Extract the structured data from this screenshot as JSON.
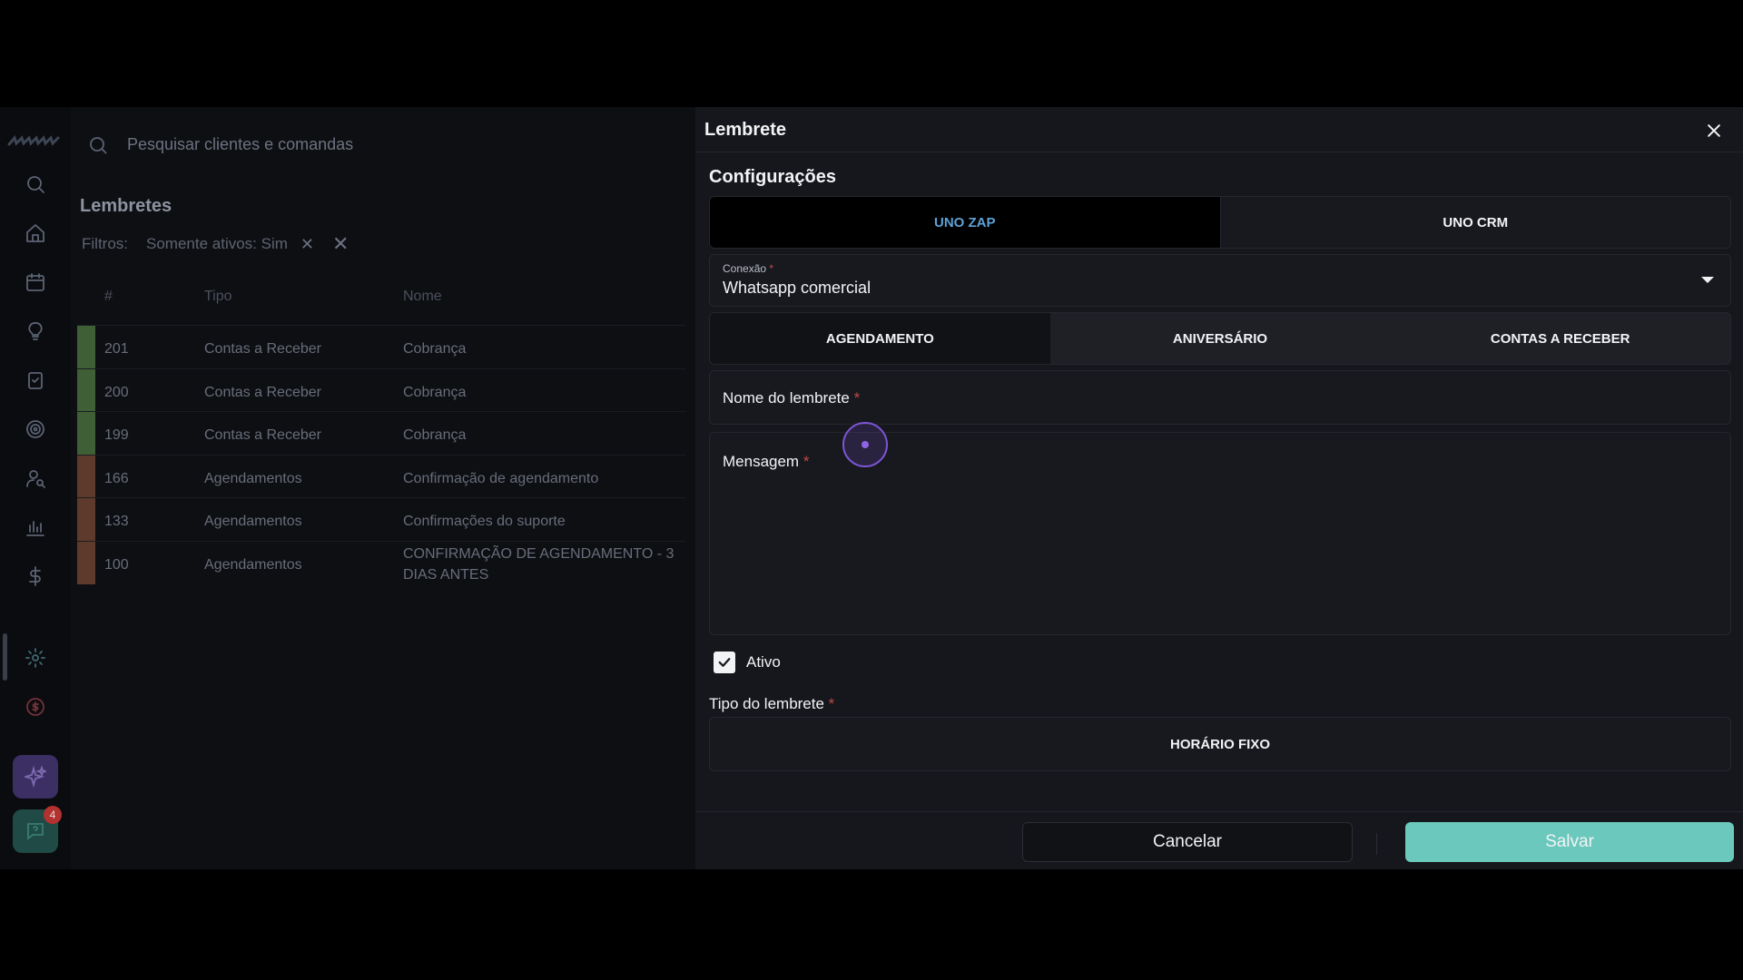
{
  "app": {
    "search": {
      "placeholder": "Pesquisar clientes e comandas"
    },
    "page_title": "Lembretes",
    "filters": {
      "label": "Filtros:",
      "chip": "Somente ativos: Sim"
    },
    "table": {
      "headers": [
        "#",
        "Tipo",
        "Nome"
      ],
      "rows": [
        {
          "id": "201",
          "tipo": "Contas a Receber",
          "nome": "Cobrança",
          "color": "#3f5f36"
        },
        {
          "id": "200",
          "tipo": "Contas a Receber",
          "nome": "Cobrança",
          "color": "#3f5f36"
        },
        {
          "id": "199",
          "tipo": "Contas a Receber",
          "nome": "Cobrança",
          "color": "#3f5f36"
        },
        {
          "id": "166",
          "tipo": "Agendamentos",
          "nome": "Confirmação de agendamento",
          "color": "#5e3a2c"
        },
        {
          "id": "133",
          "tipo": "Agendamentos",
          "nome": "Confirmações do suporte",
          "color": "#5e3a2c"
        },
        {
          "id": "100",
          "tipo": "Agendamentos",
          "nome": "CONFIRMAÇÃO DE AGENDAMENTO - 3 DIAS ANTES",
          "color": "#5e3a2c"
        }
      ]
    },
    "chat_badge": "4"
  },
  "modal": {
    "title": "Lembrete",
    "section_title": "Configurações",
    "platform_tabs": {
      "uno_zap": "UNO ZAP",
      "uno_crm": "UNO CRM"
    },
    "connection": {
      "label": "Conexão",
      "required_mark": "*",
      "value": "Whatsapp comercial"
    },
    "type_tabs": {
      "agendamento": "AGENDAMENTO",
      "aniversario": "ANIVERSÁRIO",
      "contas": "CONTAS A RECEBER"
    },
    "name_field": {
      "label": "Nome do lembrete",
      "required_mark": "*"
    },
    "message_field": {
      "label": "Mensagem",
      "required_mark": "*"
    },
    "active_checkbox": {
      "label": "Ativo",
      "checked": true
    },
    "reminder_type": {
      "label": "Tipo do lembrete",
      "required_mark": "*",
      "option": "HORÁRIO FIXO"
    },
    "buttons": {
      "cancel": "Cancelar",
      "save": "Salvar"
    }
  },
  "colors": {
    "accent": "#6bc8bd",
    "tab_active_text": "#5da2d6",
    "required": "#c04a4a"
  }
}
